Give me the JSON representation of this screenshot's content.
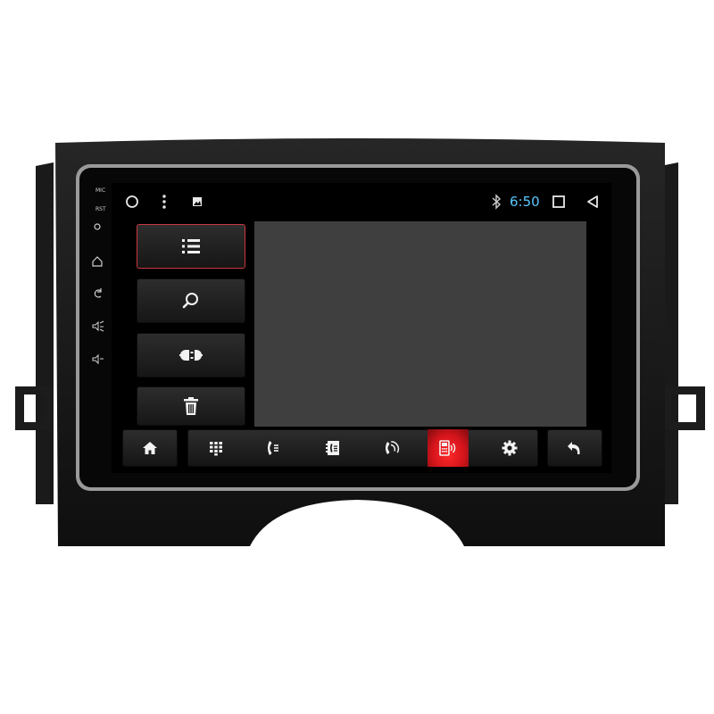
{
  "status_bar": {
    "time": "6:50",
    "icons": [
      "home-circle-icon",
      "more-vert-icon",
      "image-icon",
      "bluetooth-icon",
      "recents-square-icon",
      "back-triangle-icon"
    ]
  },
  "side_panel": {
    "items": [
      {
        "name": "list",
        "icon": "list-icon",
        "active": true
      },
      {
        "name": "search",
        "icon": "search-icon",
        "active": false
      },
      {
        "name": "pair",
        "icon": "plug-connect-icon",
        "active": false
      },
      {
        "name": "delete",
        "icon": "trash-icon",
        "active": false
      }
    ]
  },
  "dock": {
    "items": [
      {
        "name": "home",
        "icon": "home-icon",
        "active": false
      },
      {
        "name": "dialpad",
        "icon": "dialpad-icon",
        "active": false
      },
      {
        "name": "call-log",
        "icon": "call-log-icon",
        "active": false
      },
      {
        "name": "contacts",
        "icon": "contacts-icon",
        "active": false
      },
      {
        "name": "phone",
        "icon": "phone-icon",
        "active": false
      },
      {
        "name": "bluetooth-device",
        "icon": "device-signal-icon",
        "active": true
      },
      {
        "name": "settings",
        "icon": "gear-icon",
        "active": false
      },
      {
        "name": "back",
        "icon": "back-arrow-icon",
        "active": false
      }
    ]
  },
  "colors": {
    "clock": "#5ac8ff",
    "active_highlight": "#d4141b",
    "active_border": "#c9383e",
    "content_bg": "#3f3f3f"
  }
}
